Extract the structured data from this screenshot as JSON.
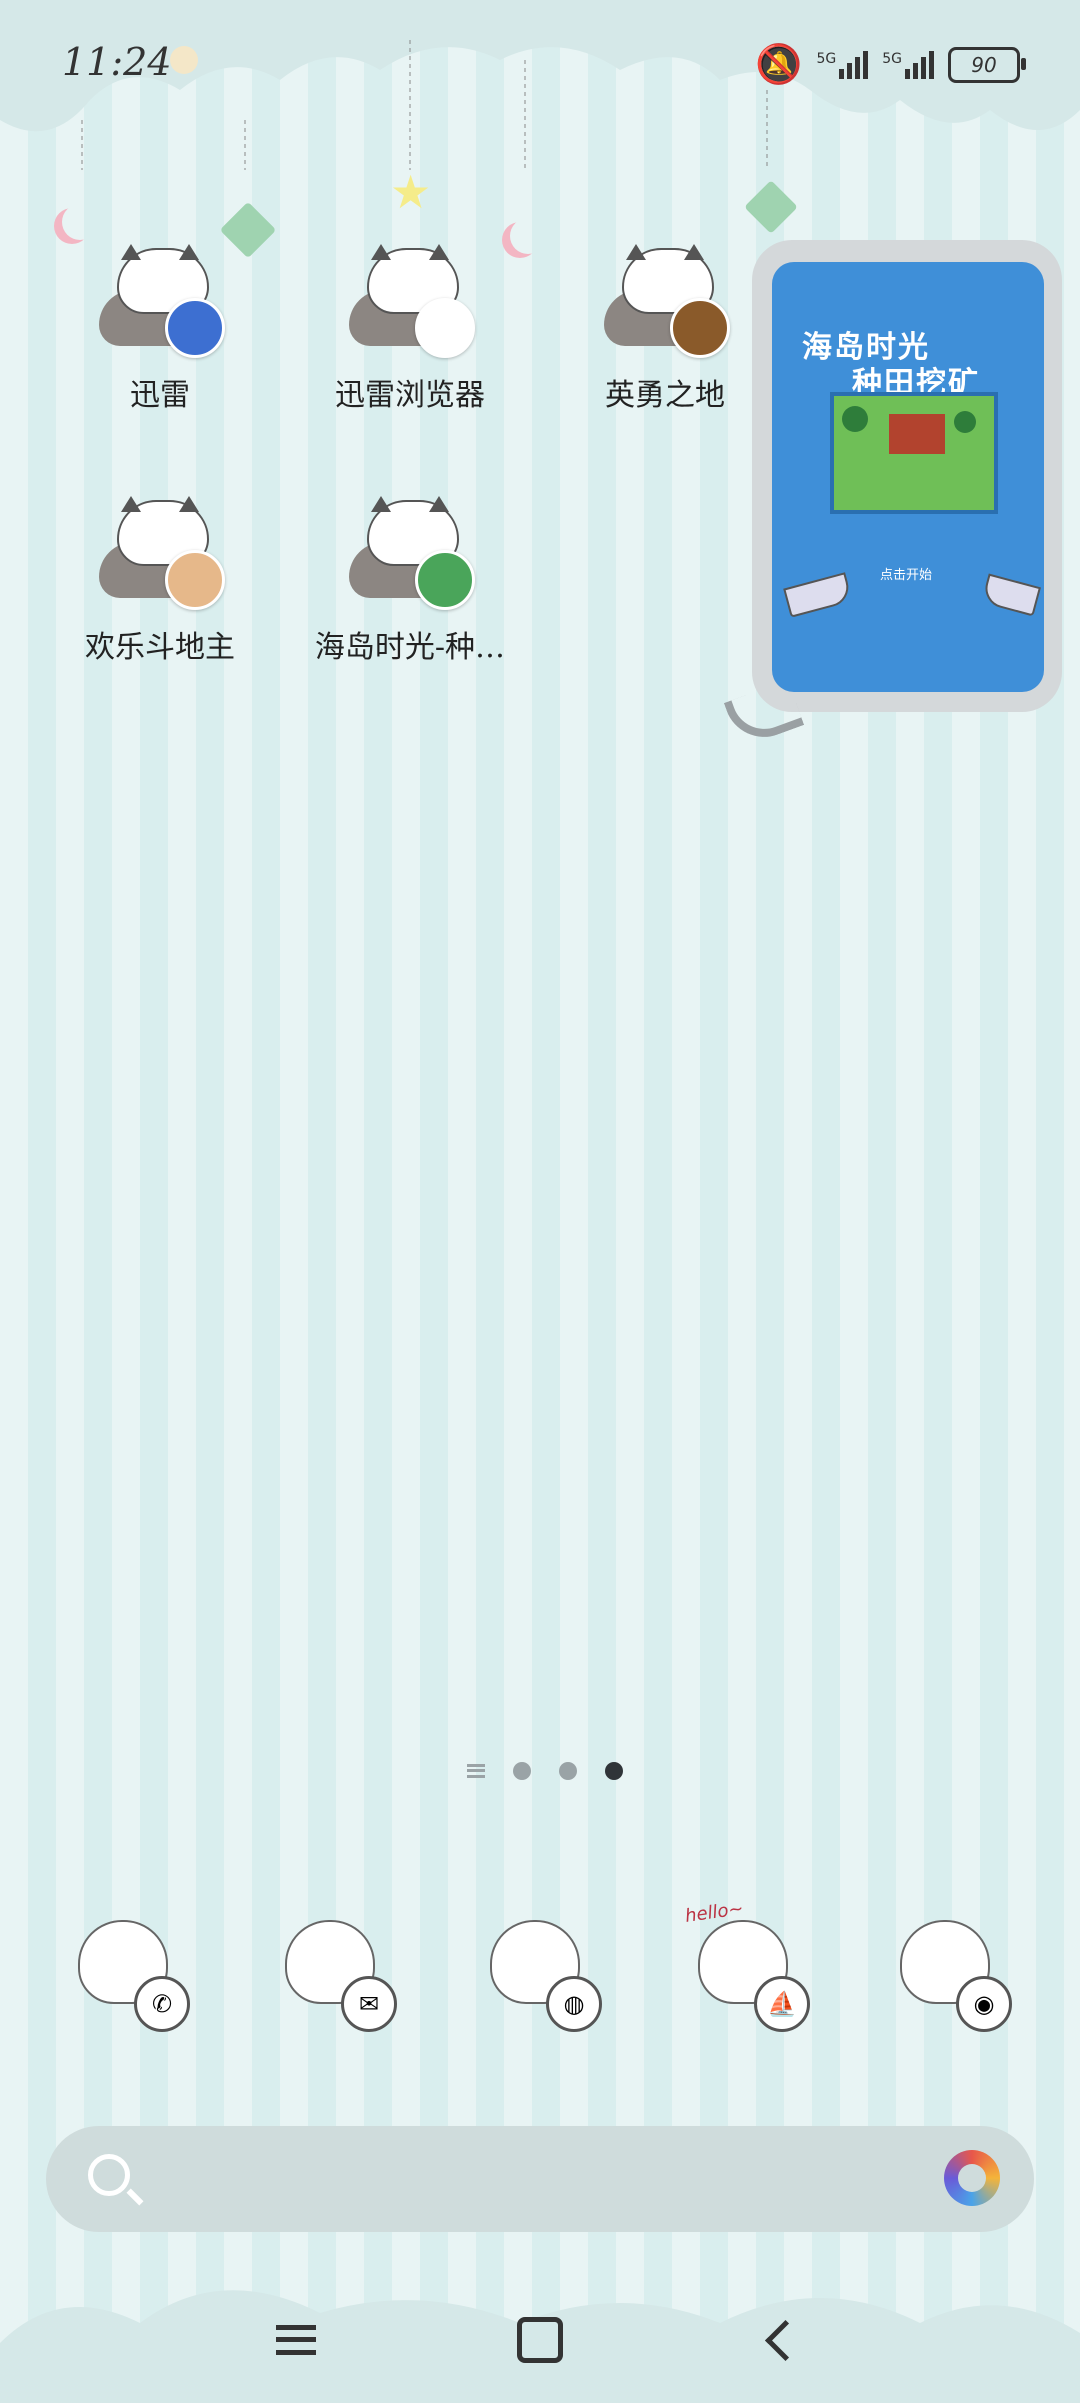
{
  "status_bar": {
    "time": "11:24",
    "signal1": "5G",
    "signal2": "5G",
    "battery": "90"
  },
  "apps": [
    {
      "label": "迅雷",
      "badge_icon": "xunlei-bird-icon",
      "badge_color": "#3d6fd1"
    },
    {
      "label": "迅雷浏览器",
      "badge_icon": "xunlei-browser-icon",
      "badge_color": "#ffffff"
    },
    {
      "label": "英勇之地",
      "badge_icon": "warrior-helmet-icon",
      "badge_color": "#8a5a2a"
    },
    {
      "label": "欢乐斗地主",
      "badge_icon": "doudizhu-face-icon",
      "badge_color": "#e6b88a"
    },
    {
      "label": "海岛时光-种…",
      "badge_icon": "island-game-icon",
      "badge_color": "#4aa55a"
    }
  ],
  "widget": {
    "title_line1": "海岛时光",
    "title_line2": "种田挖矿",
    "start_text": "点击开始"
  },
  "page_indicator": {
    "pages": 3,
    "active": 3
  },
  "dock": [
    {
      "name": "phone",
      "glyph": "✆"
    },
    {
      "name": "messages",
      "glyph": "✉"
    },
    {
      "name": "browser",
      "glyph": "◍"
    },
    {
      "name": "app-store",
      "glyph": "⛵"
    },
    {
      "name": "camera",
      "glyph": "◉"
    }
  ],
  "dock_hello_text": "hello~",
  "colors": {
    "accent": "#3f8fd8",
    "text": "#222222"
  }
}
